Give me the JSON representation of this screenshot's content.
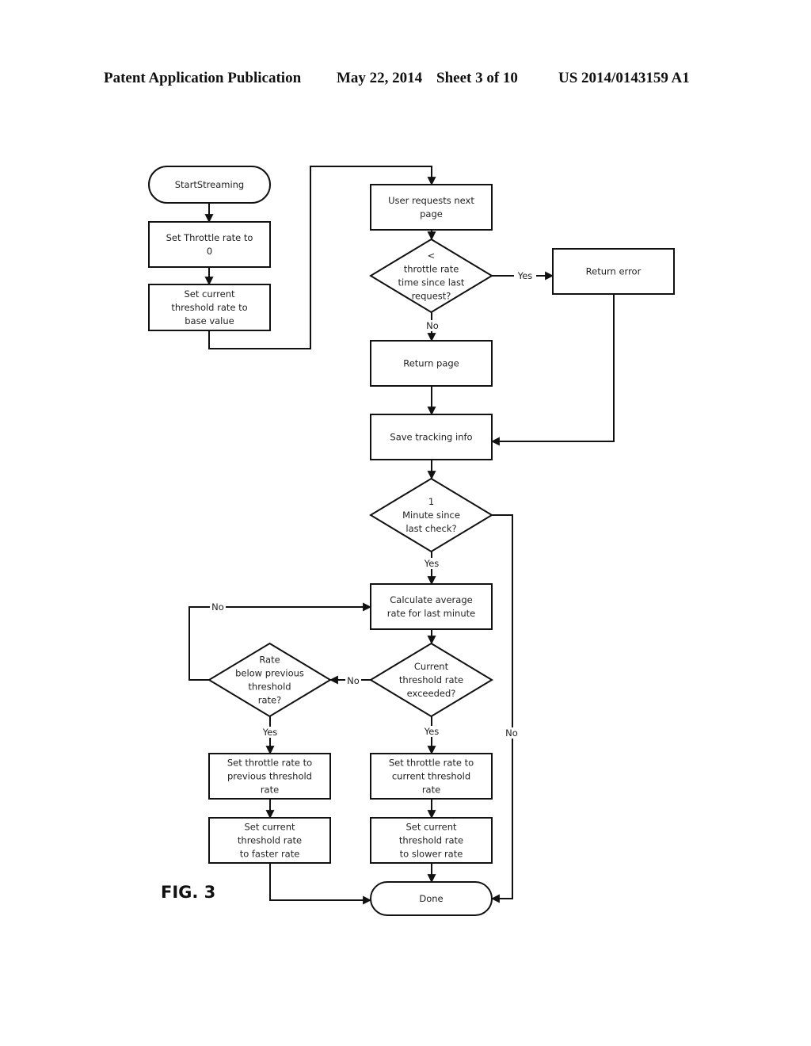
{
  "header": {
    "publication": "Patent Application Publication",
    "date": "May 22, 2014",
    "sheet": "Sheet 3 of 10",
    "number": "US 2014/0143159 A1"
  },
  "figure_label": "FIG. 3",
  "nodes": {
    "start": {
      "type": "terminator",
      "lines": [
        "StartStreaming"
      ]
    },
    "set_throttle_zero": {
      "type": "process",
      "lines": [
        "Set Throttle rate to",
        "0"
      ]
    },
    "set_threshold_base": {
      "type": "process",
      "lines": [
        "Set current",
        "threshold rate to",
        "base value"
      ]
    },
    "user_requests": {
      "type": "process",
      "lines": [
        "User requests next",
        "page"
      ]
    },
    "throttle_check": {
      "type": "decision",
      "lines": [
        "<",
        "throttle rate",
        "time since last",
        "request?"
      ]
    },
    "return_error": {
      "type": "process",
      "lines": [
        "Return error"
      ]
    },
    "return_page": {
      "type": "process",
      "lines": [
        "Return page"
      ]
    },
    "save_tracking": {
      "type": "process",
      "lines": [
        "Save tracking info"
      ]
    },
    "minute_check": {
      "type": "decision",
      "lines": [
        "1",
        "Minute since",
        "last check?"
      ]
    },
    "calc_average": {
      "type": "process",
      "lines": [
        "Calculate average",
        "rate for last minute"
      ]
    },
    "threshold_exceeded": {
      "type": "decision",
      "lines": [
        "Current",
        "threshold rate",
        "exceeded?"
      ]
    },
    "rate_below_prev": {
      "type": "decision",
      "lines": [
        "Rate",
        "below previous",
        "threshold",
        "rate?"
      ]
    },
    "set_throttle_prev": {
      "type": "process",
      "lines": [
        "Set throttle rate to",
        "previous threshold",
        "rate"
      ]
    },
    "set_threshold_faster": {
      "type": "process",
      "lines": [
        "Set current",
        "threshold rate",
        "to faster rate"
      ]
    },
    "set_throttle_current": {
      "type": "process",
      "lines": [
        "Set throttle rate to",
        "current threshold",
        "rate"
      ]
    },
    "set_threshold_slower": {
      "type": "process",
      "lines": [
        "Set current",
        "threshold rate",
        "to slower rate"
      ]
    },
    "done": {
      "type": "terminator",
      "lines": [
        "Done"
      ]
    }
  },
  "edges": [
    {
      "from": "start",
      "to": "set_throttle_zero",
      "label": ""
    },
    {
      "from": "set_throttle_zero",
      "to": "set_threshold_base",
      "label": ""
    },
    {
      "from": "set_threshold_base",
      "to": "user_requests",
      "label": ""
    },
    {
      "from": "user_requests",
      "to": "throttle_check",
      "label": ""
    },
    {
      "from": "throttle_check",
      "to": "return_error",
      "label": "Yes"
    },
    {
      "from": "throttle_check",
      "to": "return_page",
      "label": "No"
    },
    {
      "from": "return_page",
      "to": "save_tracking",
      "label": ""
    },
    {
      "from": "return_error",
      "to": "save_tracking",
      "label": ""
    },
    {
      "from": "save_tracking",
      "to": "minute_check",
      "label": ""
    },
    {
      "from": "minute_check",
      "to": "calc_average",
      "label": "Yes"
    },
    {
      "from": "minute_check",
      "to": "done",
      "label": "No"
    },
    {
      "from": "calc_average",
      "to": "threshold_exceeded",
      "label": ""
    },
    {
      "from": "threshold_exceeded",
      "to": "rate_below_prev",
      "label": "No"
    },
    {
      "from": "threshold_exceeded",
      "to": "set_throttle_current",
      "label": "Yes"
    },
    {
      "from": "rate_below_prev",
      "to": "calc_average",
      "label": "No"
    },
    {
      "from": "rate_below_prev",
      "to": "set_throttle_prev",
      "label": "Yes"
    },
    {
      "from": "set_throttle_prev",
      "to": "set_threshold_faster",
      "label": ""
    },
    {
      "from": "set_threshold_faster",
      "to": "done",
      "label": ""
    },
    {
      "from": "set_throttle_current",
      "to": "set_threshold_slower",
      "label": ""
    },
    {
      "from": "set_threshold_slower",
      "to": "done",
      "label": ""
    }
  ]
}
